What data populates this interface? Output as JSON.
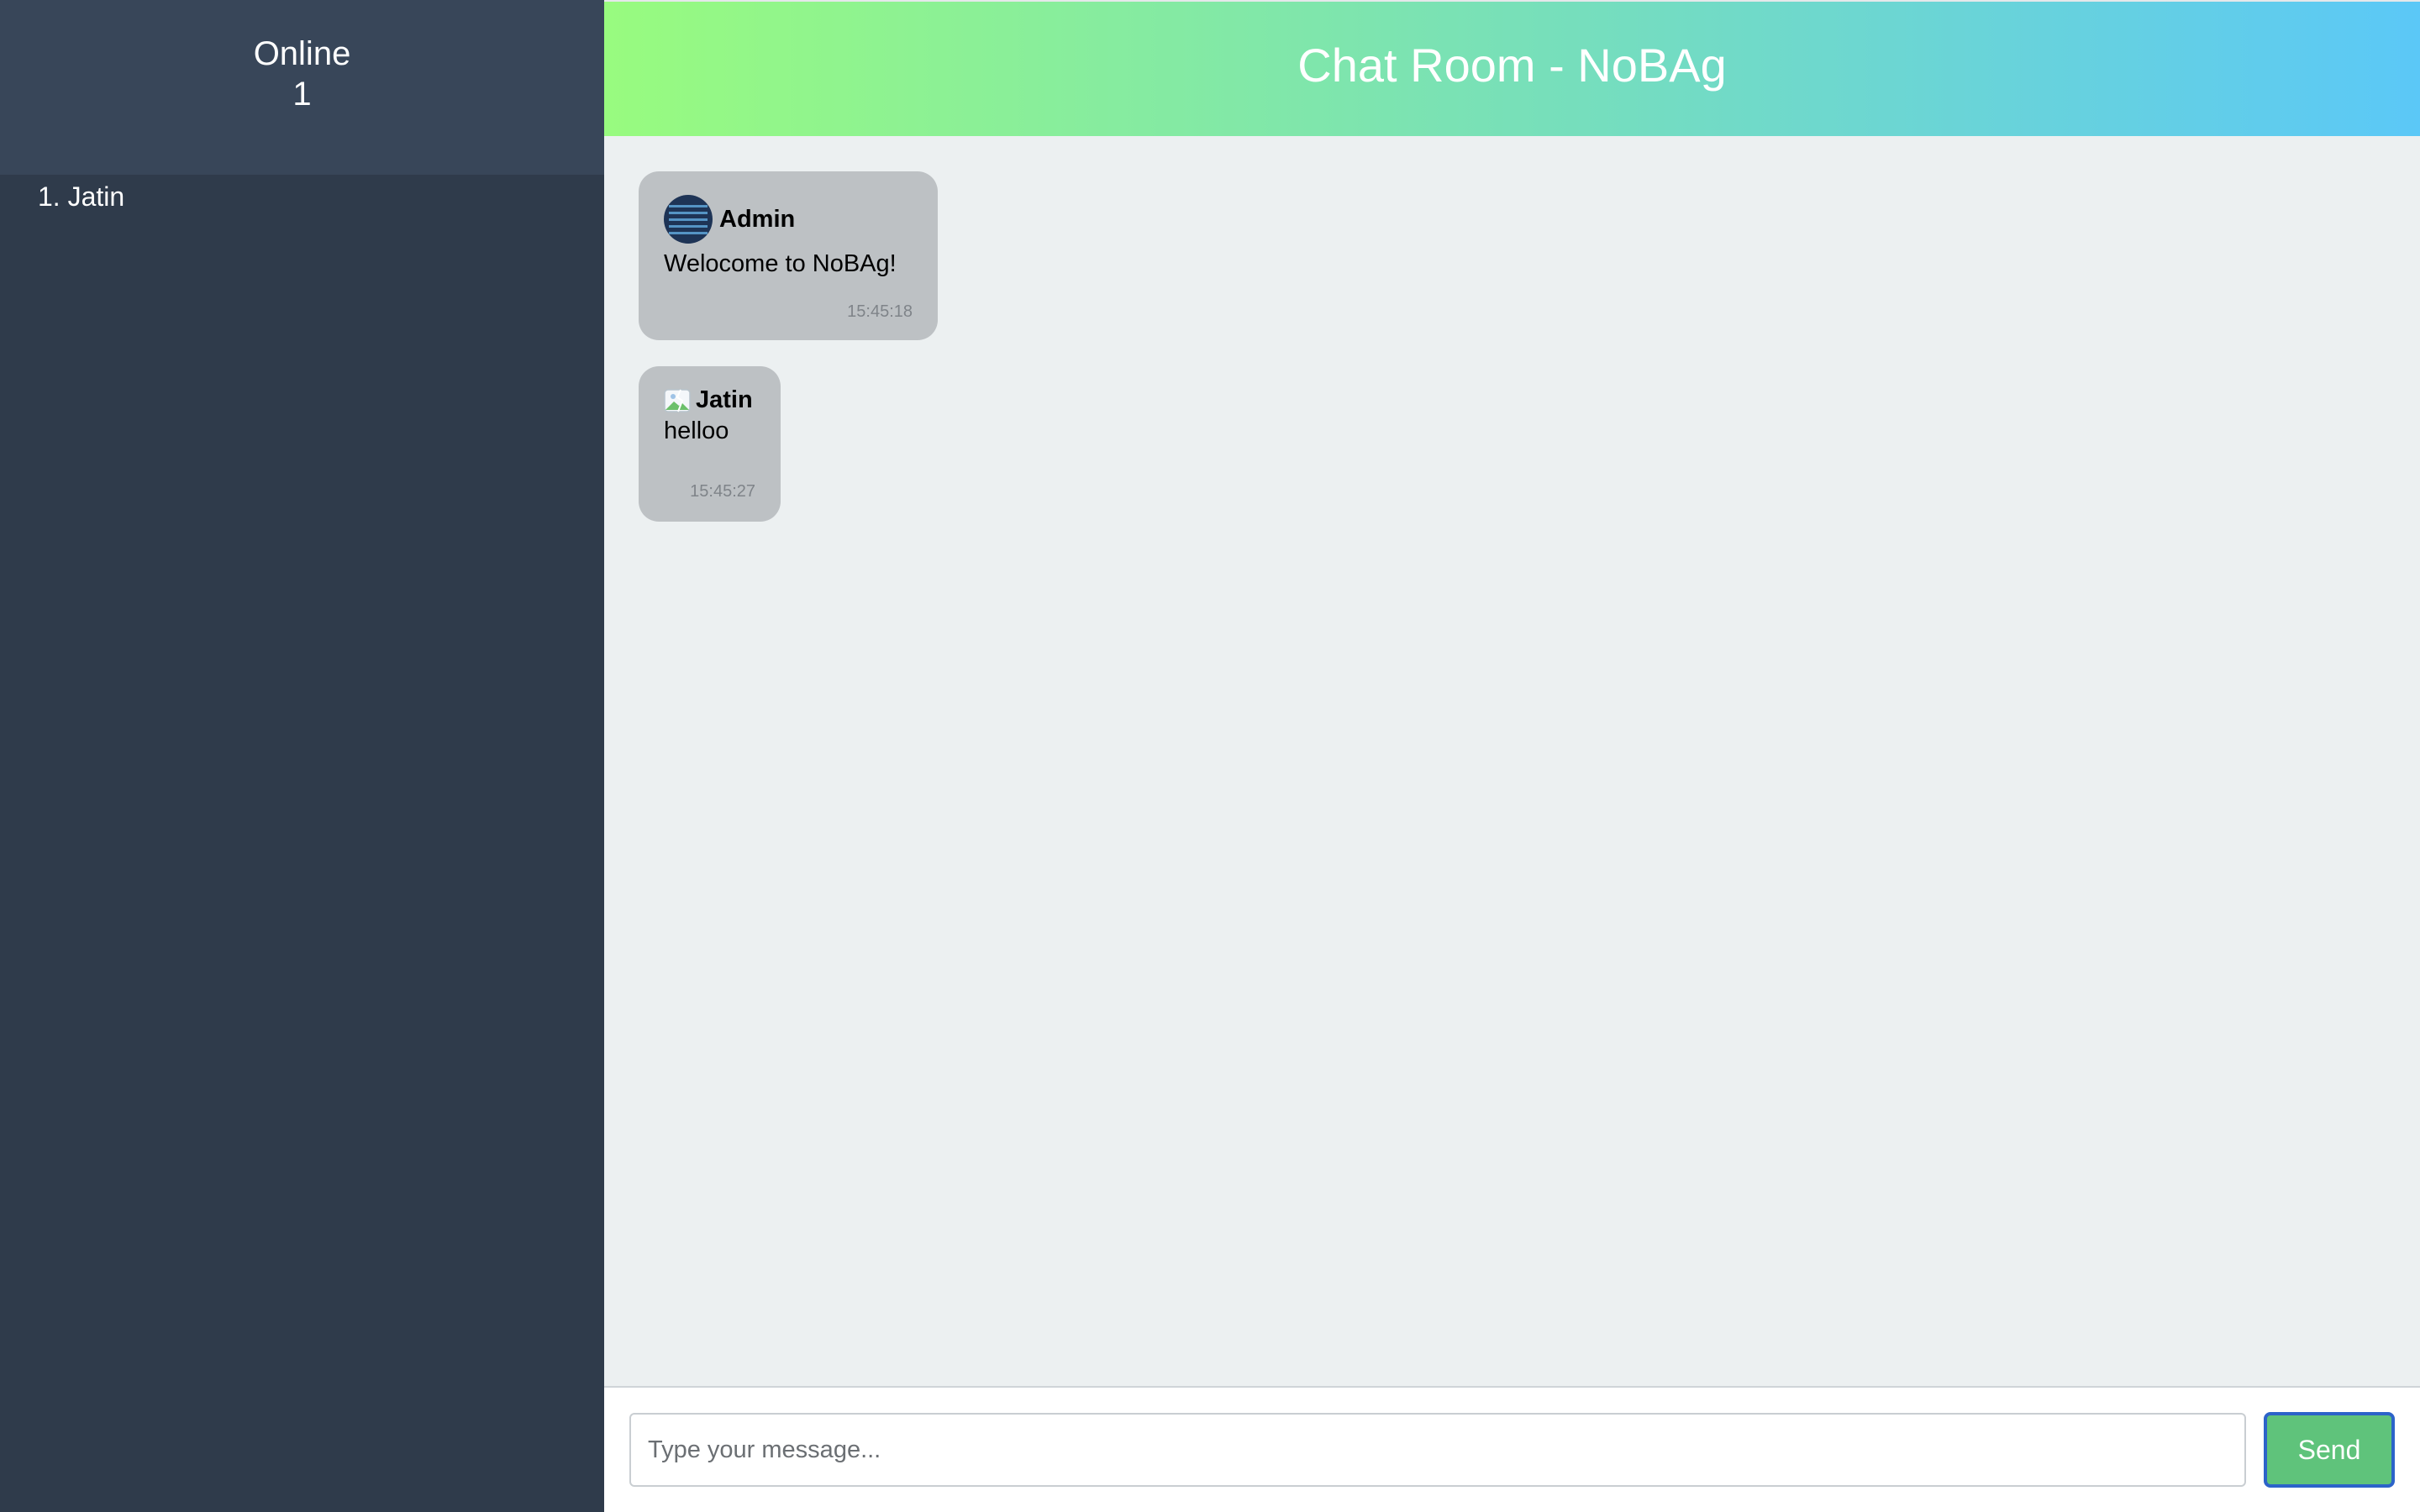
{
  "sidebar": {
    "title": "Online",
    "count": "1",
    "users": [
      "1. Jatin"
    ]
  },
  "header": {
    "title": "Chat Room - NoBAg",
    "gradient_colors": [
      "#98fb7f",
      "#5bc8f7"
    ]
  },
  "messages": [
    {
      "sender": "Admin",
      "text": "Welocome to NoBAg!",
      "time": "15:45:18",
      "avatar_icon": "admin-avatar"
    },
    {
      "sender": "Jatin",
      "text": "helloo",
      "time": "15:45:27",
      "avatar_icon": "broken-image-icon"
    }
  ],
  "composer": {
    "placeholder": "Type your message...",
    "value": "",
    "send_label": "Send",
    "send_color": "#5fc37b"
  }
}
